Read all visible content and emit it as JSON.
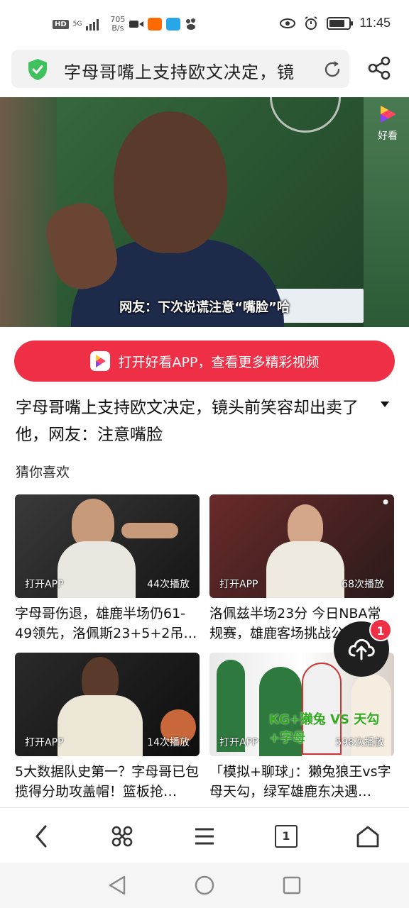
{
  "status_bar": {
    "hd": "HD",
    "signal": "5G",
    "speed_value": "705",
    "speed_unit": "B/s",
    "time": "11:45",
    "battery_level": 0.7,
    "icons": [
      "video-icon",
      "taobao-icon",
      "search-app-icon",
      "baidu-icon",
      "eye-icon",
      "alarm-icon",
      "battery-icon"
    ]
  },
  "address_bar": {
    "text": "字母哥嘴上支持欧文决定，镜",
    "secure_icon": "shield-check-icon",
    "refresh_icon": "refresh-icon",
    "share_icon": "share-icon"
  },
  "video": {
    "subtitle": "网友：下次说谎注意“嘴脸”哈",
    "badge_label": "好看"
  },
  "open_app_button": {
    "label": "打开好看APP，查看更多精彩视频"
  },
  "article": {
    "title": "字母哥嘴上支持欧文决定，镜头前笑容却出卖了他，网友：注意嘴脸"
  },
  "recommend": {
    "heading": "猜你喜欢",
    "items": [
      {
        "open_label": "打开APP",
        "plays": "44次播放",
        "title": "字母哥伤退，雄鹿半场仍61-49领先，洛佩斯23+5+2吊…"
      },
      {
        "open_label": "打开APP",
        "plays": "68次播放",
        "title": "洛佩兹半场23分 今日NBA常规赛，雄鹿客场挑战公牛"
      },
      {
        "open_label": "打开APP",
        "plays": "14次播放",
        "title": "5大数据队史第一？字母哥已包揽得分助攻盖帽！篮板抢…"
      },
      {
        "open_label": "打开APP",
        "plays": "598次播放",
        "title": "「模拟+聊球」：獭兔狼王vs字母天勾，绿军雄鹿东决遇…",
        "overlay_text": "KG+獭兔 VS 天勾+字母"
      }
    ]
  },
  "fab": {
    "badge": "1",
    "icon": "cloud-upload-icon"
  },
  "browser_bar": {
    "tabs_count": "1",
    "icons": [
      "back-icon",
      "menu-grid-icon",
      "hamburger-icon",
      "tabs-icon",
      "home-icon"
    ]
  },
  "system_nav": {
    "icons": [
      "nav-back-icon",
      "nav-home-icon",
      "nav-recents-icon"
    ]
  }
}
